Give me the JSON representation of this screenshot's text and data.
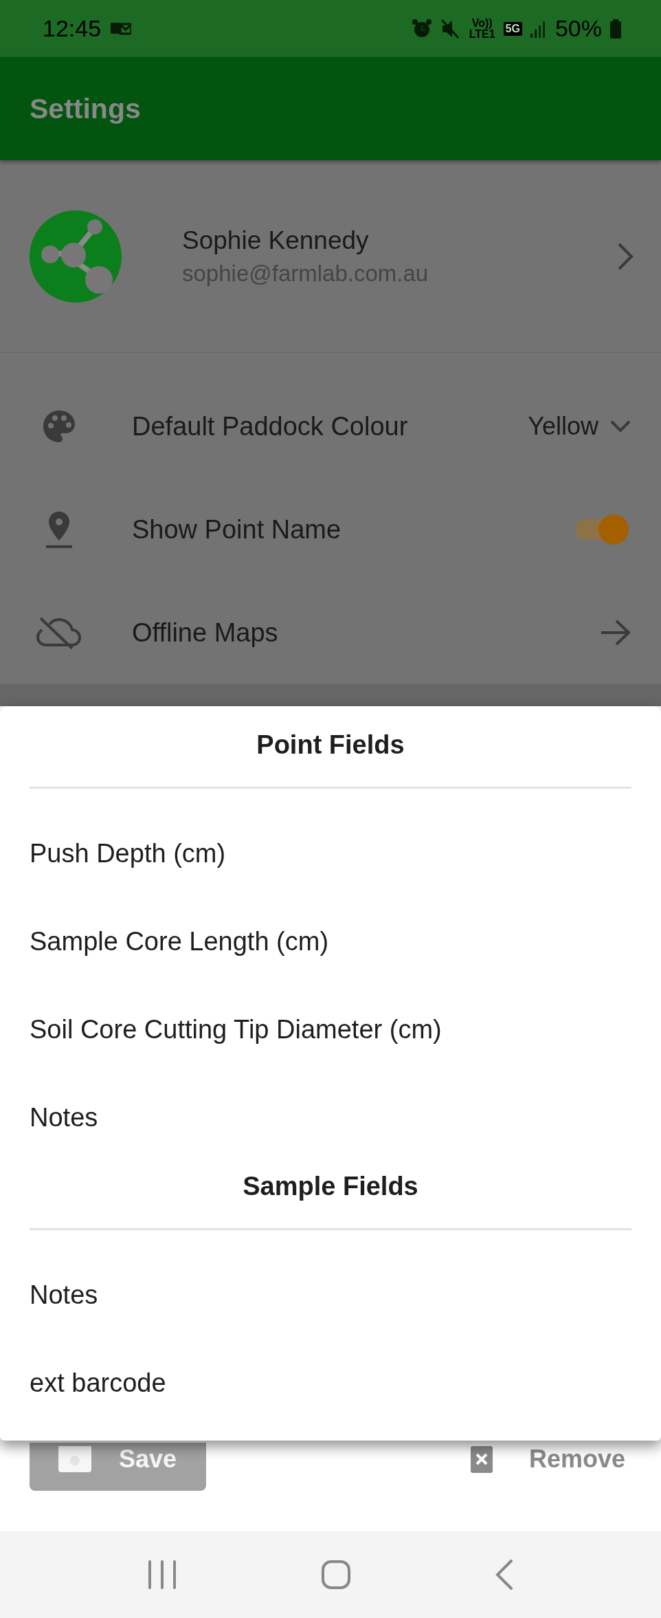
{
  "status_bar": {
    "time": "12:45",
    "volte": "Vo))",
    "lte": "LTE1",
    "network": "5G",
    "battery": "50%"
  },
  "app_bar": {
    "title": "Settings"
  },
  "profile": {
    "name": "Sophie Kennedy",
    "email": "sophie@farmlab.com.au"
  },
  "settings": [
    {
      "kind": "dropdown",
      "label": "Default Paddock Colour",
      "value": "Yellow"
    },
    {
      "kind": "toggle",
      "label": "Show Point Name",
      "on": true
    },
    {
      "kind": "link",
      "label": "Offline Maps"
    }
  ],
  "sheet": {
    "sections": [
      {
        "title": "Point Fields",
        "items": [
          "Push Depth (cm)",
          "Sample Core Length (cm)",
          "Soil Core Cutting Tip Diameter (cm)",
          "Notes"
        ]
      },
      {
        "title": "Sample Fields",
        "items": [
          "Notes",
          "ext barcode"
        ]
      }
    ]
  },
  "actions": {
    "save": {
      "label": "Save",
      "disabled": true
    },
    "remove": {
      "label": "Remove"
    }
  }
}
